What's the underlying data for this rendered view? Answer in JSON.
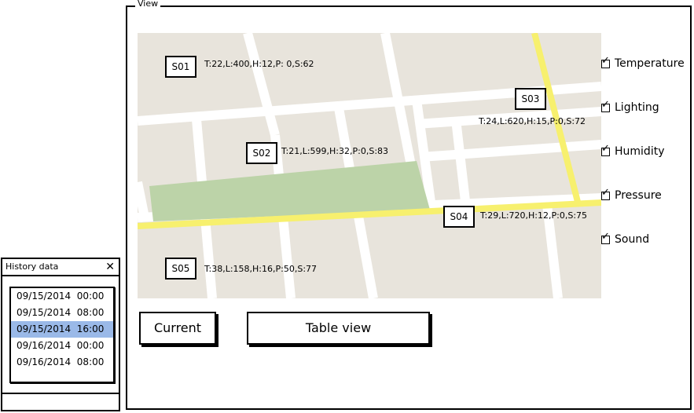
{
  "view": {
    "title": "View"
  },
  "sensors": [
    {
      "id": "S01",
      "reading": "T:22,L:400,H:12,P: 0,S:62"
    },
    {
      "id": "S02",
      "reading": "T:21,L:599,H:32,P:0,S:83"
    },
    {
      "id": "S03",
      "reading": "T:24,L:620,H:15,P:0,S:72"
    },
    {
      "id": "S04",
      "reading": "T:29,L:720,H:12,P:0,S:75"
    },
    {
      "id": "S05",
      "reading": "T:38,L:158,H:16,P:50,S:77"
    }
  ],
  "filters": [
    {
      "label": "Temperature",
      "checked": true
    },
    {
      "label": "Lighting",
      "checked": true
    },
    {
      "label": "Humidity",
      "checked": true
    },
    {
      "label": "Pressure",
      "checked": true
    },
    {
      "label": "Sound",
      "checked": true
    }
  ],
  "buttons": {
    "current": "Current",
    "table_view": "Table view"
  },
  "history": {
    "title": "History data",
    "items": [
      "09/15/2014  00:00",
      "09/15/2014  08:00",
      "09/15/2014  16:00",
      "09/16/2014  00:00",
      "09/16/2014  08:00"
    ],
    "selected_index": 2
  },
  "colors": {
    "map_bg": "#e8e4dc",
    "road": "#ffffff",
    "highway": "#f7f06e",
    "park": "#bcd3a8",
    "selection": "#9ab9e8"
  }
}
